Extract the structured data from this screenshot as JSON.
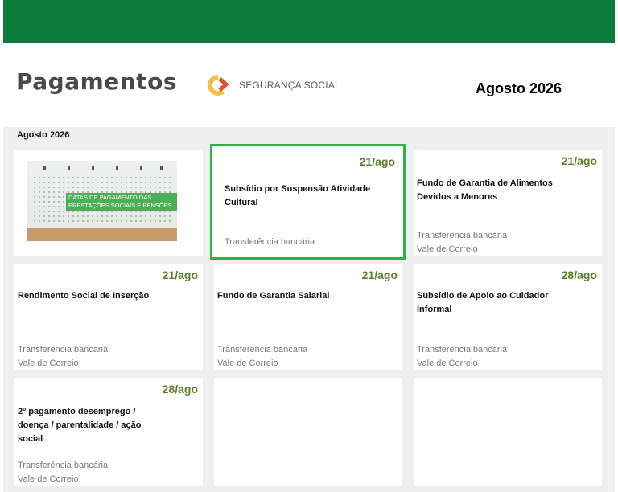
{
  "header": {
    "title": "Pagamentos",
    "logo_text": "SEGURANÇA SOCIAL",
    "month": "Agosto 2026"
  },
  "panel": {
    "title": "Agosto 2026"
  },
  "image": {
    "banner_line1": "DATAS DE PAGAMENTO DAS",
    "banner_line2": "PRESTAÇÕES SOCIAIS E PENSÕES"
  },
  "cards": [
    {
      "date": "21/ago",
      "title": "Subsídio por Suspensão Atividade Cultural",
      "methods": [
        "Transferência bancária"
      ]
    },
    {
      "date": "21/ago",
      "title": "Fundo de Garantia de Alimentos Devidos a Menores",
      "methods": [
        "Transferência bancária",
        "Vale de Correio"
      ]
    },
    {
      "date": "21/ago",
      "title": "Rendimento Social de Inserção",
      "methods": [
        "Transferência bancária",
        "Vale de Correio"
      ]
    },
    {
      "date": "21/ago",
      "title": "Fundo de Garantia Salarial",
      "methods": [
        "Transferência bancária",
        "Vale de Correio"
      ]
    },
    {
      "date": "28/ago",
      "title": "Subsídio de Apoio ao Cuidador Informal",
      "methods": [
        "Transferência bancária",
        "Vale de Correio"
      ]
    },
    {
      "date": "28/ago",
      "title": "2º pagamento desemprego / doença / parentalidade / ação social",
      "methods": [
        "Transferência bancária",
        "Vale de Correio"
      ]
    }
  ],
  "colors": {
    "topbar": "#0a7a3d",
    "accent_date": "#5b7f2a",
    "highlight_border": "#2eb24a"
  }
}
